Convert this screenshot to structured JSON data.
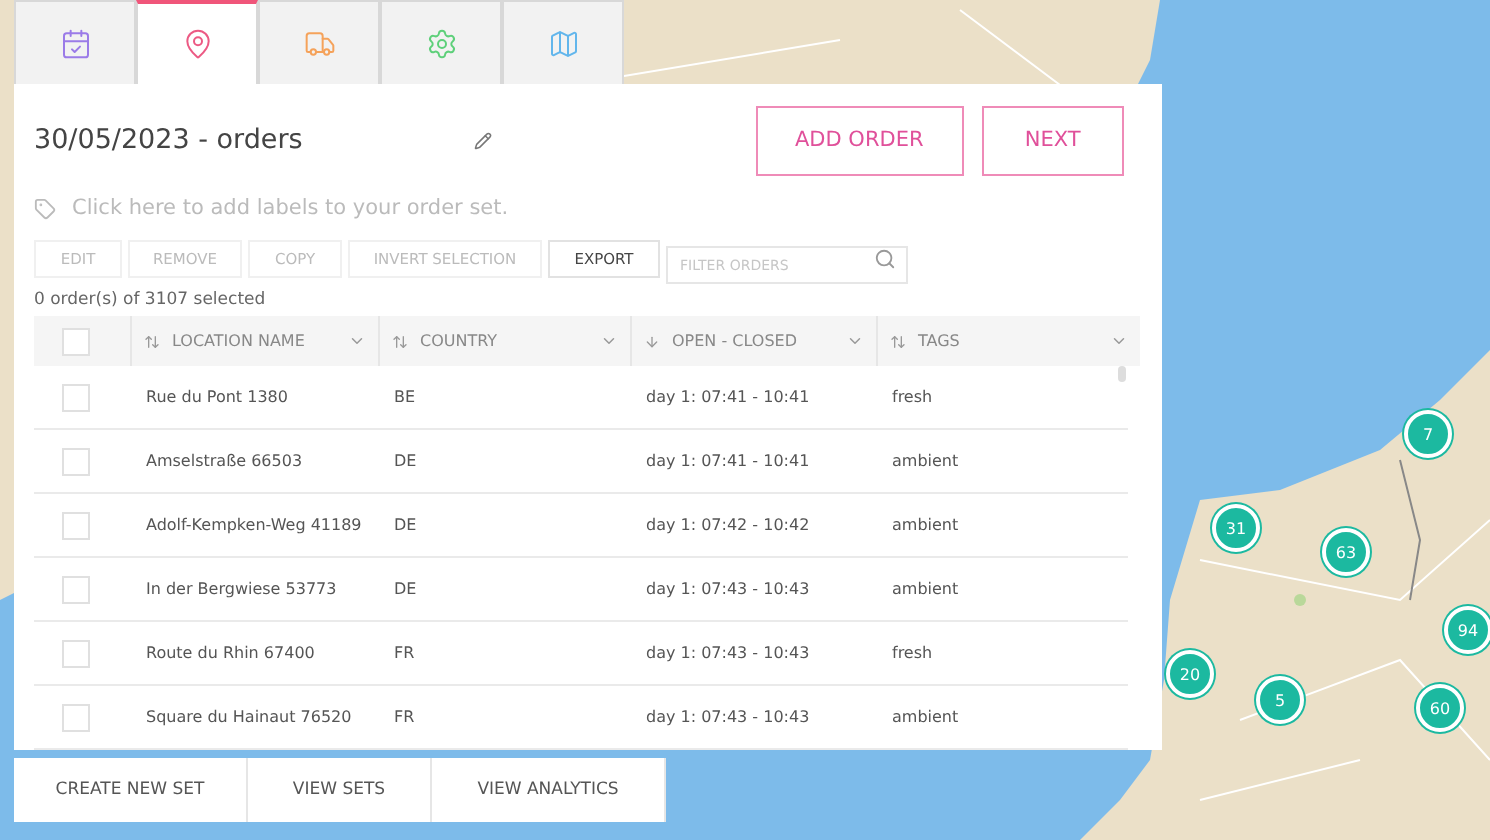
{
  "tabs": [
    {
      "kind": "calendar",
      "selected": false
    },
    {
      "kind": "pin",
      "selected": true
    },
    {
      "kind": "truck",
      "selected": false
    },
    {
      "kind": "gear",
      "selected": false
    },
    {
      "kind": "map",
      "selected": false
    }
  ],
  "panel": {
    "title": "30/05/2023 - orders",
    "labels_placeholder": "Click here to add labels to your order set.",
    "actions": [
      "ADD ORDER",
      "NEXT"
    ],
    "toolbar": [
      {
        "label": "EDIT",
        "disabled": true
      },
      {
        "label": "REMOVE",
        "disabled": true
      },
      {
        "label": "COPY",
        "disabled": true
      },
      {
        "label": "INVERT SELECTION",
        "disabled": true
      },
      {
        "label": "EXPORT",
        "disabled": false
      }
    ],
    "filter": {
      "placeholder": "FILTER ORDERS"
    },
    "selection_count": "0 order(s) of 3107 selected",
    "table": {
      "all_checked": false,
      "columns": [
        {
          "label": "LOCATION NAME",
          "kind": "sortable"
        },
        {
          "label": "COUNTRY",
          "kind": "sortable"
        },
        {
          "label": "OPEN - CLOSED",
          "kind": "sorted"
        },
        {
          "label": "TAGS",
          "kind": "sortable"
        }
      ],
      "rows": [
        {
          "checked": false,
          "cells": [
            "Rue du Pont 1380",
            "BE",
            "day 1: 07:41 - 10:41",
            "fresh"
          ]
        },
        {
          "checked": false,
          "cells": [
            "Amselstraße 66503",
            "DE",
            "day 1: 07:41 - 10:41",
            "ambient"
          ]
        },
        {
          "checked": false,
          "cells": [
            "Adolf-Kempken-Weg 41189",
            "DE",
            "day 1: 07:42 - 10:42",
            "ambient"
          ]
        },
        {
          "checked": false,
          "cells": [
            "In der Bergwiese 53773",
            "DE",
            "day 1: 07:43 - 10:43",
            "ambient"
          ]
        },
        {
          "checked": false,
          "cells": [
            "Route du Rhin 67400",
            "FR",
            "day 1: 07:43 - 10:43",
            "fresh"
          ]
        },
        {
          "checked": false,
          "cells": [
            "Square du Hainaut 76520",
            "FR",
            "day 1: 07:43 - 10:43",
            "ambient"
          ]
        }
      ]
    }
  },
  "bottom_bar": [
    "CREATE NEW SET",
    "VIEW SETS",
    "VIEW ANALYTICS"
  ],
  "map": {
    "kind": "picture",
    "markers": [
      "7",
      "31",
      "63",
      "20",
      "5",
      "94",
      "60"
    ]
  }
}
